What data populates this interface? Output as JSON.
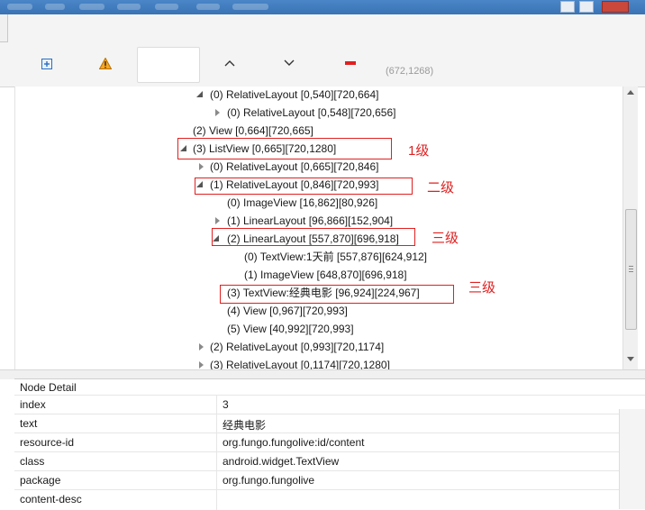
{
  "toolbar": {
    "coords": "(672,1268)",
    "buttons": [
      {
        "name": "expand-all-icon"
      },
      {
        "name": "warning-icon"
      },
      {
        "name": "chevron-up-icon"
      },
      {
        "name": "chevron-down-icon"
      },
      {
        "name": "collapse-icon"
      }
    ]
  },
  "tree": {
    "nodes": [
      "(0) RelativeLayout [0,540][720,664]",
      "(0) RelativeLayout [0,548][720,656]",
      "(2) View [0,664][720,665]",
      "(3) ListView [0,665][720,1280]",
      "(0) RelativeLayout [0,665][720,846]",
      "(1) RelativeLayout [0,846][720,993]",
      "(0) ImageView [16,862][80,926]",
      "(1) LinearLayout [96,866][152,904]",
      "(2) LinearLayout [557,870][696,918]",
      "(0) TextView:1天前 [557,876][624,912]",
      "(1) ImageView [648,870][696,918]",
      "(3) TextView:经典电影 [96,924][224,967]",
      "(4) View [0,967][720,993]",
      "(5) View [40,992][720,993]",
      "(2) RelativeLayout [0,993][720,1174]",
      "(3) RelativeLayout [0,1174][720,1280]"
    ],
    "annotations": [
      "1级",
      "二级",
      "三级",
      "三级"
    ]
  },
  "detail": {
    "title": "Node Detail",
    "rows": [
      {
        "key": "index",
        "value": "3"
      },
      {
        "key": "text",
        "value": "经典电影"
      },
      {
        "key": "resource-id",
        "value": "org.fungo.fungolive:id/content"
      },
      {
        "key": "class",
        "value": "android.widget.TextView"
      },
      {
        "key": "package",
        "value": "org.fungo.fungolive"
      },
      {
        "key": "content-desc",
        "value": ""
      }
    ]
  },
  "colors": {
    "annotation": "#e02020",
    "selection": "#d5e8fa",
    "warning": "#f5a623",
    "collapse": "#e02020",
    "expand": "#2a6fc0"
  }
}
